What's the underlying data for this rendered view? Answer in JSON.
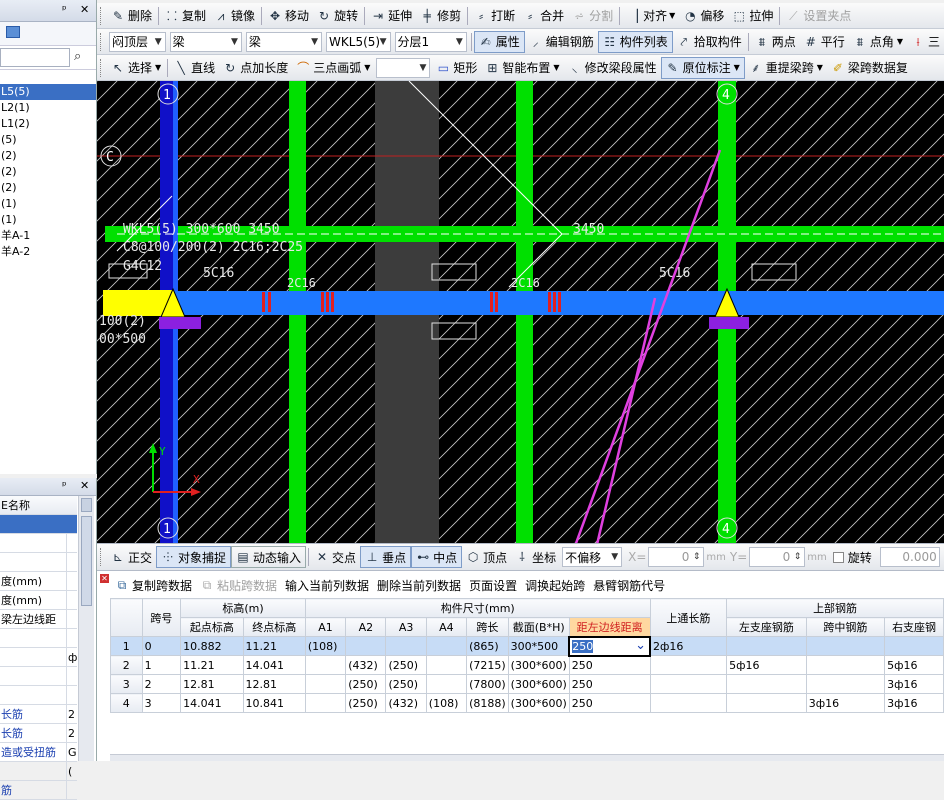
{
  "toolbar1": {
    "items": [
      {
        "label": "删除",
        "icon": "delete-icon"
      },
      {
        "label": "复制",
        "icon": "copy-icon"
      },
      {
        "label": "镜像",
        "icon": "mirror-icon"
      },
      {
        "label": "移动",
        "icon": "move-icon"
      },
      {
        "label": "旋转",
        "icon": "rotate-icon"
      },
      {
        "label": "延伸",
        "icon": "extend-icon"
      },
      {
        "label": "修剪",
        "icon": "trim-icon"
      },
      {
        "label": "打断",
        "icon": "break-icon"
      },
      {
        "label": "合并",
        "icon": "merge-icon"
      },
      {
        "label": "分割",
        "icon": "split-icon"
      },
      {
        "label": "对齐",
        "icon": "align-icon"
      },
      {
        "label": "偏移",
        "icon": "offset-icon"
      },
      {
        "label": "拉伸",
        "icon": "stretch-icon"
      },
      {
        "label": "设置夹点",
        "icon": "grip-icon"
      }
    ]
  },
  "toolbar2": {
    "floor": "闷顶层",
    "category": "梁",
    "type": "梁",
    "component": "WKL5(5)",
    "layer": "分层1",
    "attr_label": "属性",
    "edit_rebar_label": "编辑钢筋",
    "list_label": "构件列表",
    "pick_label": "拾取构件",
    "twopoint_label": "两点",
    "parallel_label": "平行",
    "pointangle_label": "点角",
    "three_label": "三"
  },
  "toolbar3": {
    "select_label": "选择",
    "line_label": "直线",
    "pointlen_label": "点加长度",
    "arc_label": "三点画弧",
    "rect_label": "矩形",
    "smart_label": "智能布置",
    "modify_label": "修改梁段属性",
    "inplace_label": "原位标注",
    "reextract_label": "重提梁跨",
    "spandata_label": "梁跨数据复"
  },
  "left_top": {
    "pin": "ㅁ",
    "close": "✕",
    "tree": [
      "L5(5)",
      "L2(1)",
      "L1(2)",
      "(5)",
      "(2)",
      "(2)",
      "(2)",
      "(1)",
      "(1)",
      "羊A-1",
      "羊A-2"
    ]
  },
  "left_props": {
    "header": "E名称",
    "rows": [
      {
        "label": "",
        "val": ""
      },
      {
        "label": "",
        "val": ""
      },
      {
        "label": "度(mm)",
        "val": ""
      },
      {
        "label": "度(mm)",
        "val": ""
      },
      {
        "label": "梁左边线距",
        "val": ""
      },
      {
        "label": "",
        "val": ""
      },
      {
        "label": "",
        "val": "ф"
      },
      {
        "label": "",
        "val": ""
      },
      {
        "label": "",
        "val": ""
      },
      {
        "label": "长筋",
        "val": "2"
      },
      {
        "label": "长筋",
        "val": "2"
      },
      {
        "label": "造或受扭筋",
        "val": "G"
      },
      {
        "label": "",
        "val": "("
      },
      {
        "label": "筋",
        "val": ""
      }
    ]
  },
  "canvas": {
    "axis_top_1": "1",
    "axis_top_2": "4",
    "axis_bottom_1": "1",
    "axis_bottom_2": "4",
    "axis_c": "C",
    "label_beam": "WKL5(5) 300*600 3450",
    "label_stirrup": "C8@100/200(2) 2C16;2C25",
    "label_g": "G4C12",
    "label_5c16_a": "5C16",
    "label_5c16_b": "5C16",
    "label_3450": "3450",
    "label_2c16_a": "2C16",
    "label_2c16_b": "2C16",
    "label_left1": "100(2)",
    "label_left2": "00*500",
    "ucs_y": "Y",
    "ucs_x": "X"
  },
  "statusbar": {
    "ortho": "正交",
    "snap": "对象捕捉",
    "dyn": "动态输入",
    "intersect": "交点",
    "perp": "垂点",
    "mid": "中点",
    "vertex": "顶点",
    "coord": "坐标",
    "offset_mode": "不偏移",
    "x_label": "X=",
    "x_val": "0",
    "y_label": "Y=",
    "y_val": "0",
    "unit": "mm",
    "rotate_label": "旋转",
    "rotate_val": "0.000"
  },
  "grid_toolbar": {
    "copy": "复制跨数据",
    "paste": "粘贴跨数据",
    "input_col": "输入当前列数据",
    "delete_col": "删除当前列数据",
    "page_setup": "页面设置",
    "swap_start": "调换起始跨",
    "cantilever": "悬臂钢筋代号"
  },
  "table": {
    "h_span": "跨号",
    "h_elev": "标高(m)",
    "h_size": "构件尺寸(mm)",
    "h_top_long": "上通长筋",
    "h_top_rebar": "上部钢筋",
    "h_start_elev": "起点标高",
    "h_end_elev": "终点标高",
    "h_a1": "A1",
    "h_a2": "A2",
    "h_a3": "A3",
    "h_a4": "A4",
    "h_spanlen": "跨长",
    "h_section": "截面(B*H)",
    "h_edge": "距左边线距离",
    "h_left_seat": "左支座钢筋",
    "h_mid": "跨中钢筋",
    "h_right_seat": "右支座钢",
    "rows": [
      {
        "n": "1",
        "span": "0",
        "start": "10.882",
        "end": "11.21",
        "a1": "(108)",
        "a2": "",
        "a3": "",
        "a4": "",
        "len": "(865)",
        "sec": "300*500",
        "edge": "250",
        "toplong": "2ф16",
        "left": "",
        "mid": "",
        "right": ""
      },
      {
        "n": "2",
        "span": "1",
        "start": "11.21",
        "end": "14.041",
        "a1": "",
        "a2": "(432)",
        "a3": "(250)",
        "a4": "",
        "len": "(7215)",
        "sec": "(300*600)",
        "edge": "250",
        "toplong": "",
        "left": "5ф16",
        "mid": "",
        "right": "5ф16"
      },
      {
        "n": "3",
        "span": "2",
        "start": "12.81",
        "end": "12.81",
        "a1": "",
        "a2": "(250)",
        "a3": "(250)",
        "a4": "",
        "len": "(7800)",
        "sec": "(300*600)",
        "edge": "250",
        "toplong": "",
        "left": "",
        "mid": "",
        "right": "3ф16"
      },
      {
        "n": "4",
        "span": "3",
        "start": "14.041",
        "end": "10.841",
        "a1": "",
        "a2": "(250)",
        "a3": "(432)",
        "a4": "(108)",
        "len": "(8188)",
        "sec": "(300*600)",
        "edge": "250",
        "toplong": "",
        "left": "",
        "mid": "3ф16",
        "right": "3ф16"
      }
    ]
  },
  "colors": {
    "canvas_bg": "#000000",
    "column_green": "#00e000",
    "beam_blue": "#1e78ff",
    "support_yellow": "#ffff00",
    "annotation_magenta": "#e040e0",
    "selection_blue": "#c7dcf6"
  }
}
